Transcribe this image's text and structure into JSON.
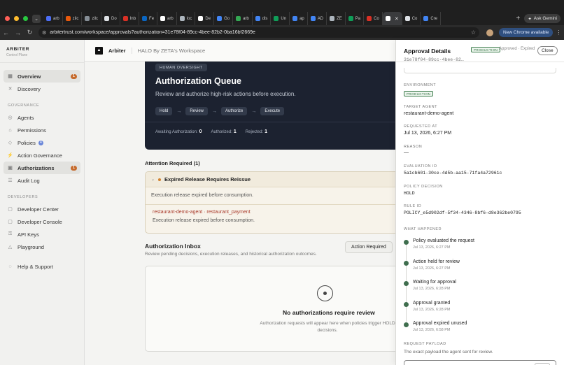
{
  "browser": {
    "tabs": [
      {
        "label": "arb",
        "color": "#4c6ef5"
      },
      {
        "label": "zilc",
        "color": "#e8590c"
      },
      {
        "label": "zilc",
        "color": "#868e96"
      },
      {
        "label": "Do",
        "color": "#dee2e6"
      },
      {
        "label": "Inb",
        "color": "#d93025"
      },
      {
        "label": "Fe",
        "color": "#0a66c2"
      },
      {
        "label": "arb",
        "color": "#ffffff"
      },
      {
        "label": "loc",
        "color": "#adb5bd"
      },
      {
        "label": "De",
        "color": "#ffffff"
      },
      {
        "label": "Go",
        "color": "#4285f4"
      },
      {
        "label": "arb",
        "color": "#34a853"
      },
      {
        "label": "dis",
        "color": "#4285f4"
      },
      {
        "label": "Un",
        "color": "#0f9d58"
      },
      {
        "label": "ap",
        "color": "#4285f4"
      },
      {
        "label": "AD",
        "color": "#4285f4"
      },
      {
        "label": "ZE",
        "color": "#adb5bd"
      },
      {
        "label": "Pa",
        "color": "#0f9d58"
      },
      {
        "label": "Co",
        "color": "#d93025"
      },
      {
        "label": "",
        "color": "#ffffff",
        "active": true
      },
      {
        "label": "Co",
        "color": "#dee2e6"
      },
      {
        "label": "Cre",
        "color": "#4285f4"
      }
    ],
    "ask_gemini": "Ask Gemini",
    "url": "arbitertrust.com/workspace/approvals?authorization=31e78f04-89cc-4bee-82b2-0ba16bf2669e",
    "chrome_available": "New Chrome available"
  },
  "sidebar": {
    "brand": "ARBITER",
    "brand_sub": "Control Plane",
    "items_top": [
      {
        "label": "Overview",
        "icon": "grid-icon",
        "glyph": "▦",
        "badge": "1",
        "active": true
      },
      {
        "label": "Discovery",
        "icon": "discovery-icon",
        "glyph": "✕"
      }
    ],
    "governance_heading": "GOVERNANCE",
    "items_gov": [
      {
        "label": "Agents",
        "icon": "agents-icon",
        "glyph": "◎"
      },
      {
        "label": "Permissions",
        "icon": "permissions-icon",
        "glyph": "⌂"
      },
      {
        "label": "Policies",
        "icon": "policies-icon",
        "glyph": "◇",
        "badge_blue": "4"
      },
      {
        "label": "Action Governance",
        "icon": "action-governance-icon",
        "glyph": "⚡"
      },
      {
        "label": "Authorizations",
        "icon": "authorizations-icon",
        "glyph": "▣",
        "badge": "1",
        "active": true
      },
      {
        "label": "Audit Log",
        "icon": "audit-log-icon",
        "glyph": "☰"
      }
    ],
    "developers_heading": "DEVELOPERS",
    "items_dev": [
      {
        "label": "Developer Center",
        "icon": "developer-center-icon",
        "glyph": "▢"
      },
      {
        "label": "Developer Console",
        "icon": "developer-console-icon",
        "glyph": "▢"
      },
      {
        "label": "API Keys",
        "icon": "api-keys-icon",
        "glyph": "⚿"
      },
      {
        "label": "Playground",
        "icon": "playground-icon",
        "glyph": "△"
      }
    ],
    "help": {
      "label": "Help & Support",
      "icon": "help-icon",
      "glyph": "◌"
    }
  },
  "topbar": {
    "app_name": "Arbiter",
    "workspace": "HALO By ZETA's Workspace"
  },
  "hero": {
    "tag": "HUMAN OVERSIGHT",
    "title": "Authorization Queue",
    "description": "Review and authorize high-risk actions before execution.",
    "steps": [
      "Hold",
      "Review",
      "Authorize",
      "Execute"
    ],
    "stats": [
      {
        "label": "Awaiting Authorization:",
        "value": "0"
      },
      {
        "label": "Authorized:",
        "value": "1"
      },
      {
        "label": "Rejected:",
        "value": "1"
      }
    ]
  },
  "attention": {
    "heading": "Attention Required (1)",
    "title": "Expired Release Requires Reissue",
    "body": "Execution release expired before consumption.",
    "ref": "restaurant-demo-agent · restaurant_payment",
    "ref_body": "Execution release expired before consumption."
  },
  "inbox": {
    "title": "Authorization Inbox",
    "description": "Review pending decisions, execution releases, and historical authorization outcomes.",
    "action_required": "Action Required",
    "empty_title": "No authorizations require review",
    "empty_desc": "Authorization requests will appear here when policies trigger HOLD decisions."
  },
  "panel": {
    "title": "Approval Details",
    "env_badge": "PRODUCTION",
    "status": "Approved · Expired",
    "close": "Close",
    "id_short": "31e78f04-89cc-4bee-82…",
    "fields": {
      "environment_label": "ENVIRONMENT",
      "environment_value": "PRODUCTION",
      "target_agent_label": "TARGET AGENT",
      "target_agent_value": "restaurant-demo-agent",
      "requested_at_label": "REQUESTED AT",
      "requested_at_value": "Jul 13, 2026, 6:27 PM",
      "reason_label": "REASON",
      "reason_value": "—",
      "evaluation_id_label": "EVALUATION ID",
      "evaluation_id_value": "5a1cb601-30ce-4d5b-aa15-71fa4a72961c",
      "policy_decision_label": "POLICY DECISION",
      "policy_decision_value": "HOLD",
      "rule_id_label": "RULE ID",
      "rule_id_value": "POLICY_e5d902df-5f34-4346-8bf6-d8e362be0795"
    },
    "what_happened_label": "WHAT HAPPENED",
    "timeline": [
      {
        "title": "Policy evaluated the request",
        "time": "Jul 13, 2026, 6:27 PM"
      },
      {
        "title": "Action held for review",
        "time": "Jul 13, 2026, 6:27 PM"
      },
      {
        "title": "Waiting for approval",
        "time": "Jul 13, 2026, 6:28 PM"
      },
      {
        "title": "Approval granted",
        "time": "Jul 13, 2026, 6:28 PM"
      },
      {
        "title": "Approval expired unused",
        "time": "Jul 13, 2026, 6:58 PM"
      }
    ],
    "payload_label": "REQUEST PAYLOAD",
    "payload_desc": "The exact payload the agent sent for review."
  }
}
